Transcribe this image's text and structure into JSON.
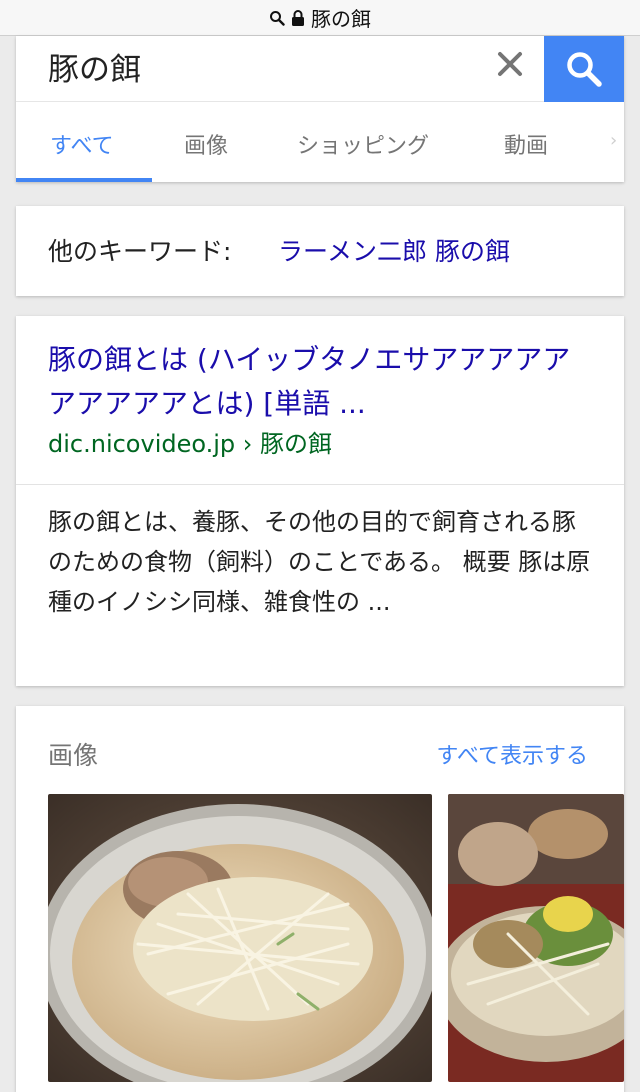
{
  "status_bar": {
    "url_text": "豚の餌",
    "icons": [
      "search-icon",
      "lock-icon"
    ]
  },
  "search": {
    "query": "豚の餌",
    "clear_icon": "close-icon",
    "submit_icon": "search-icon"
  },
  "tabs": [
    {
      "label": "すべて",
      "active": true
    },
    {
      "label": "画像",
      "active": false
    },
    {
      "label": "ショッピング",
      "active": false
    },
    {
      "label": "動画",
      "active": false
    }
  ],
  "related": {
    "label": "他のキーワード:",
    "link": "ラーメン二郎 豚の餌"
  },
  "result": {
    "title": "豚の餌とは (ハイッブタノエサアアアアアアアアアアとは) [単語 ...",
    "url_domain": "dic.nicovideo.jp",
    "url_path": "› 豚の餌",
    "snippet": "豚の餌とは、養豚、その他の目的で飼育される豚のための食物（飼料）のことである。 概要 豚は原種のイノシシ同様、雑食性の ..."
  },
  "images": {
    "heading": "画像",
    "view_all": "すべて表示する",
    "thumbnails": [
      {
        "subject": "bowl-of-noodles-with-bean-sprouts"
      },
      {
        "subject": "bowl-of-noodles-red-table"
      }
    ]
  },
  "colors": {
    "accent": "#4285f4",
    "link": "#1a0dab",
    "url": "#006621"
  }
}
